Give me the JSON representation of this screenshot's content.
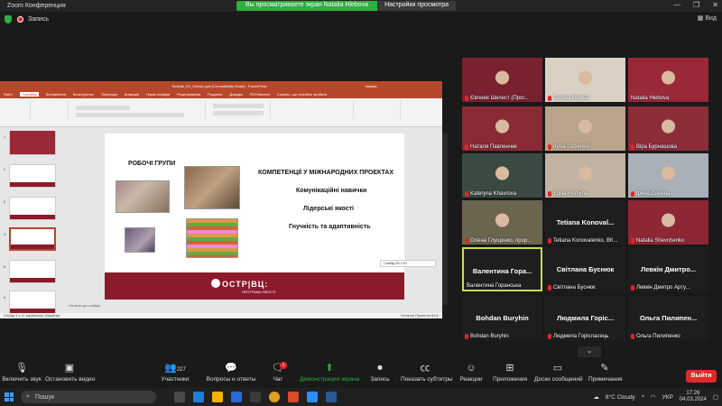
{
  "window": {
    "title": "Zoom Конференция"
  },
  "share": {
    "viewing": "Вы просматриваете экран Natalia Hlebova",
    "settings": "Настройки просмотра"
  },
  "topbar": {
    "recording": "Запись",
    "view": "Вид"
  },
  "ppt": {
    "filename": "Tertiulia_R1_Ostroh.pptx [Compatibility Mode] - PowerPoint",
    "user": "Natalia",
    "menu": [
      "Файл",
      "Головна",
      "Вставлення",
      "Конструктор",
      "Переходи",
      "Анімація",
      "Показ слайдів",
      "Рецензування",
      "Подання",
      "Довідка",
      "PDFelement",
      "Скажіть, що потрібно зробити"
    ],
    "notes": "Нотатки до слайда",
    "status_left": "Слайд 4 з 11",
    "status_lang": "українська (Україна)",
    "status_right": "Нотатки   Примітки   81%",
    "hint": "Слайд 28 з 51",
    "thumb_numbers": [
      "1",
      "2",
      "3",
      "4",
      "5",
      "6"
    ]
  },
  "slide": {
    "left_heading": "РОБОЧІ ГРУПИ",
    "title": "КОМПЕТЕНЦІЇ У МІЖНАРОДНИХ ПРОЕКТАХ",
    "items": [
      "Комунікаційні навички",
      "Лідерські якості",
      "Гнучкість та адаптивність"
    ],
    "logo": "ОСТР|ВЦ:",
    "logo_sub": "ПРОГРАМА ЯКОСТІ"
  },
  "participants": [
    {
      "name": "Євгенія Шелест (Прог...",
      "label": "",
      "muted": true,
      "video": true,
      "color": "#7a2130"
    },
    {
      "name": "Тетяна Мухіна",
      "label": "",
      "muted": true,
      "video": true,
      "color": "#d9cfc2"
    },
    {
      "name": "Natalia Hlebova",
      "label": "",
      "muted": false,
      "video": true,
      "color": "#9a2838"
    },
    {
      "name": "Наталя Павленчик",
      "label": "",
      "muted": true,
      "video": true,
      "color": "#8a2a35"
    },
    {
      "name": "Iryna Torbenko",
      "label": "",
      "muted": true,
      "video": true,
      "color": "#b8a48a"
    },
    {
      "name": "Віра Бурнашова",
      "label": "",
      "muted": true,
      "video": true,
      "color": "#8c2d3a"
    },
    {
      "name": "Kateryna Khavrova",
      "label": "",
      "muted": true,
      "video": true,
      "color": "#3a4a40"
    },
    {
      "name": "Yuliia Remyha",
      "label": "",
      "muted": true,
      "video": true,
      "color": "#c0b3a3"
    },
    {
      "name": "Ірина Донець",
      "label": "",
      "muted": true,
      "video": true,
      "color": "#a9b0b8"
    },
    {
      "name": "Олена Глущенко, прор...",
      "label": "",
      "muted": true,
      "video": true,
      "color": "#6b6550"
    },
    {
      "name": "Tetiana Konovalenko, ВК...",
      "label": "Tetiana  Konoval...",
      "muted": true,
      "video": false,
      "color": "#1e1e1e"
    },
    {
      "name": "Natalia Shevchenko",
      "label": "",
      "muted": true,
      "video": true,
      "color": "#8e2636"
    },
    {
      "name": "Валентина Горанська",
      "label": "Валентина  Гора...",
      "muted": false,
      "video": false,
      "color": "#1e1e1e"
    },
    {
      "name": "Світлана Буснюк",
      "label": "Світлана Буснюк",
      "muted": true,
      "video": false,
      "color": "#1e1e1e"
    },
    {
      "name": "Левкін Дмитро Арту...",
      "label": "Левкін  Дмитро...",
      "muted": true,
      "video": false,
      "color": "#1e1e1e"
    },
    {
      "name": "Bohdan Buryhin",
      "label": "Bohdan Buryhin",
      "muted": true,
      "video": false,
      "color": "#1e1e1e"
    },
    {
      "name": "Людмила Горісласець",
      "label": "Людмила  Горіс...",
      "muted": true,
      "video": false,
      "color": "#1e1e1e"
    },
    {
      "name": "Ольга Пилипенко",
      "label": "Ольга  Пилипен...",
      "muted": true,
      "video": false,
      "color": "#1e1e1e"
    }
  ],
  "toolbar": {
    "unmute": "Включить звук",
    "stop_video": "Остановить видео",
    "participants": "Участники",
    "participants_count": "227",
    "qa": "Вопросы и ответы",
    "chat": "Чат",
    "chat_badge": "1",
    "share": "Демонстрация экрана",
    "record": "Запись",
    "captions": "Показать субтитры",
    "reactions": "Реакции",
    "apps": "Приложения",
    "whiteboards": "Доски сообщений",
    "notes": "Примечания",
    "leave": "Выйти"
  },
  "taskbar": {
    "search": "Пошук",
    "weather": "8°C  Cloudy",
    "lang": "УКР",
    "time": "17:26",
    "date": "04.03.2024"
  },
  "colors": {
    "accent": "#2dae40",
    "brand": "#8b1a2b",
    "leave": "#e02a2a",
    "speaker": "#c8e04a"
  }
}
